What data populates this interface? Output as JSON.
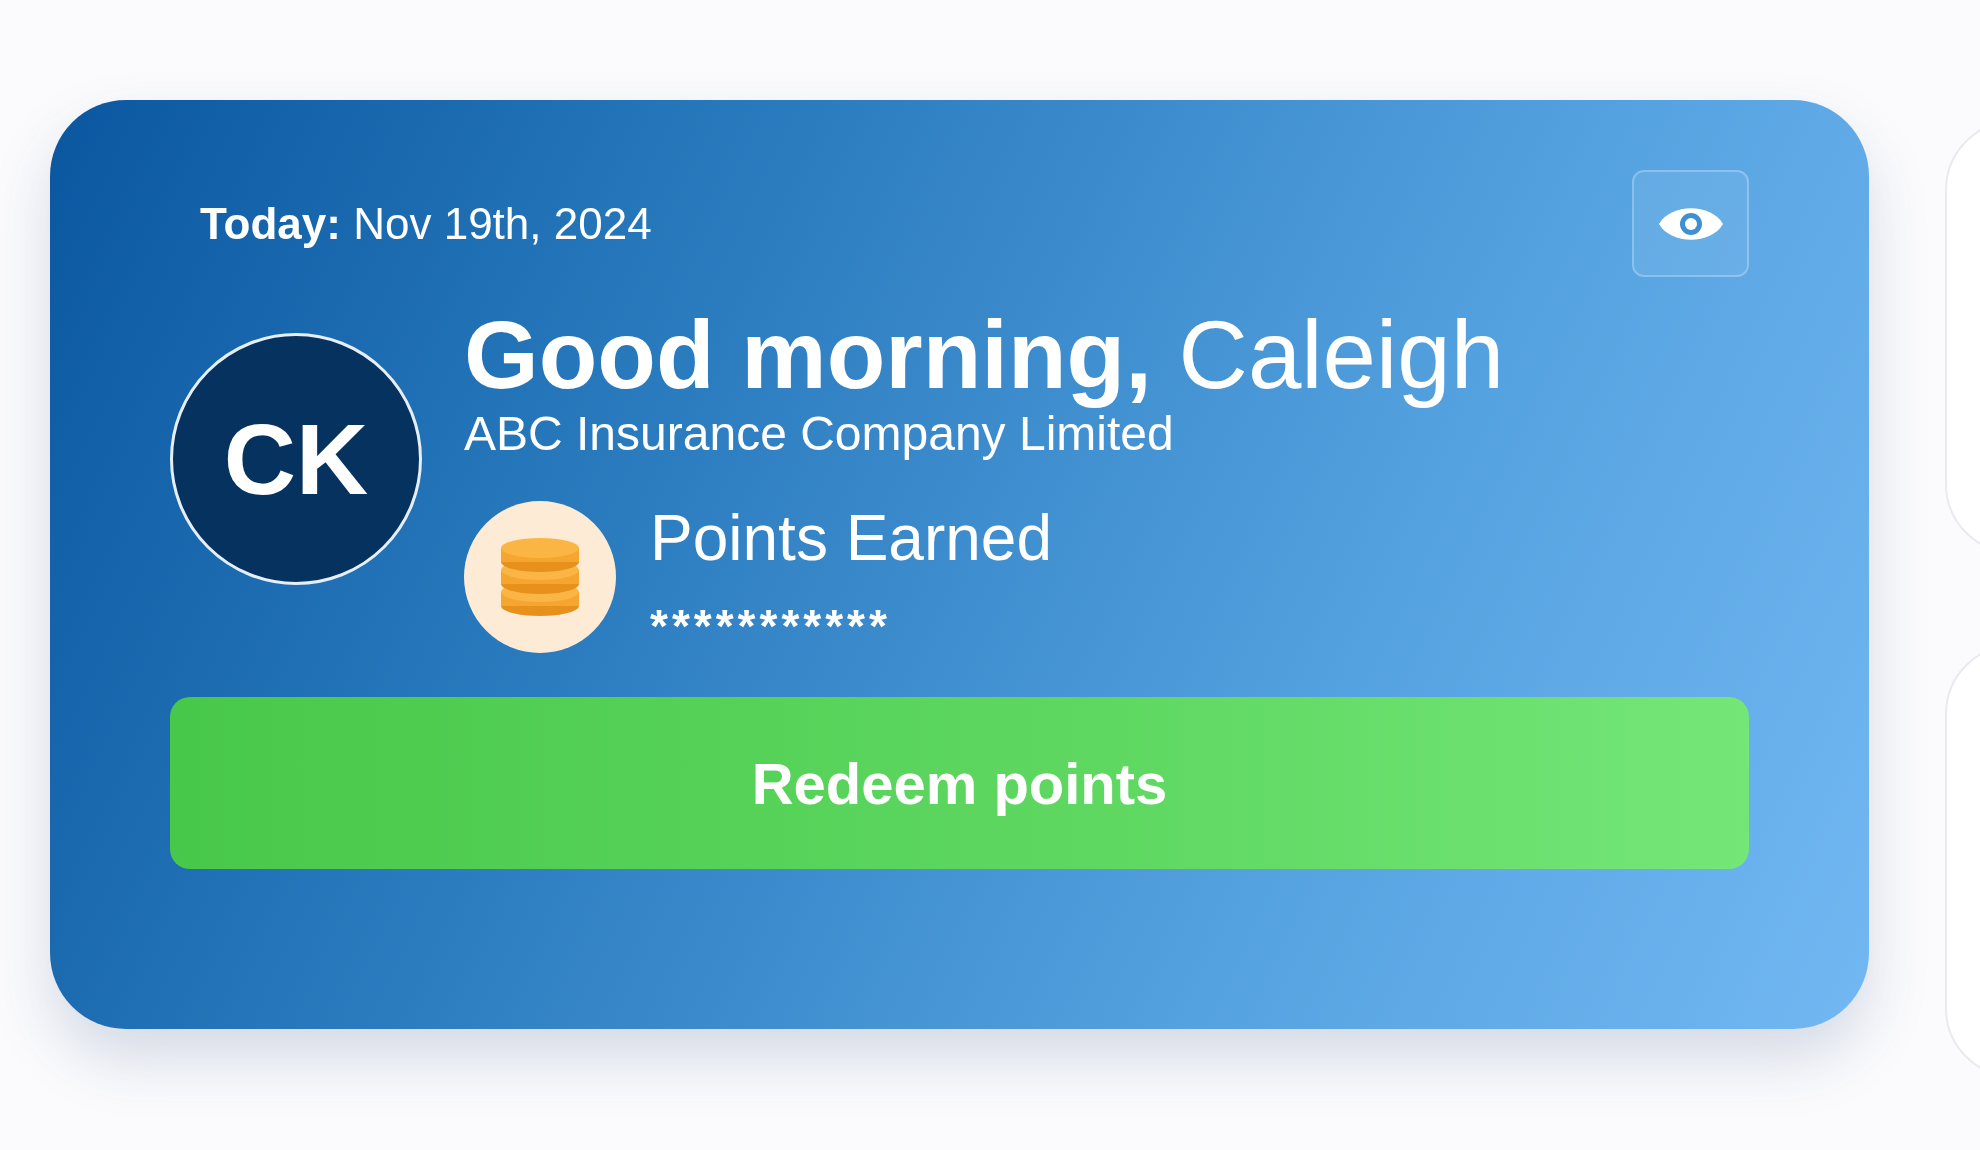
{
  "card": {
    "date_label": "Today:",
    "date": "Nov 19th, 2024",
    "avatar_initials": "CK",
    "greeting": "Good morning,",
    "name": "Caleigh",
    "company": "ABC Insurance Company Limited",
    "points_label": "Points Earned",
    "points_value": "***********",
    "button": "Redeem points"
  }
}
